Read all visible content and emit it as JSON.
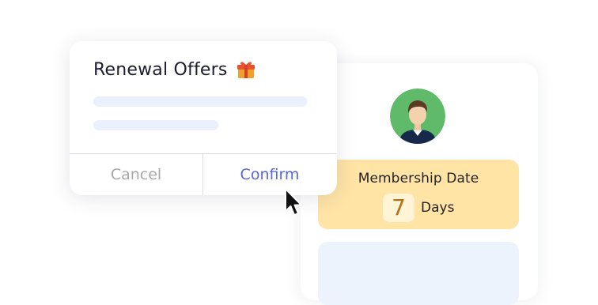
{
  "dialog": {
    "title": "Renewal Offers",
    "title_icon": "gift-icon",
    "cancel_label": "Cancel",
    "confirm_label": "Confirm"
  },
  "profile": {
    "avatar_icon": "user-avatar",
    "membership_title": "Membership Date",
    "days_value": "7",
    "days_label": "Days"
  },
  "colors": {
    "confirm": "#5b67d6",
    "cancel": "#a9a9a9",
    "membership_bg": "#ffe4a6",
    "avatar_bg": "#5fba6a",
    "days_number": "#b1731a"
  }
}
